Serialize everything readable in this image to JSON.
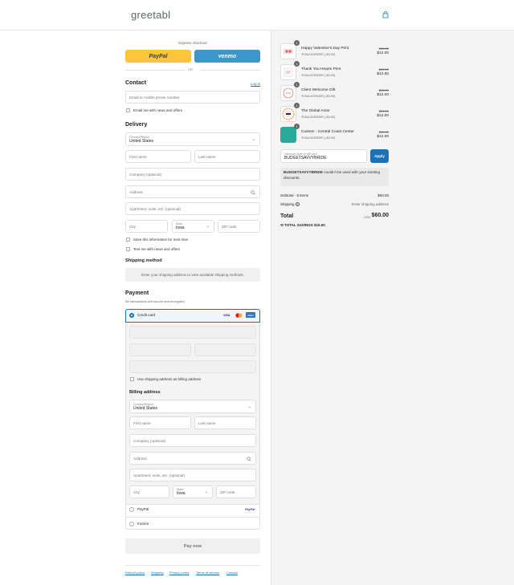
{
  "header": {
    "logo": "greetabl"
  },
  "express": {
    "title": "Express checkout",
    "paypal": "PayPal",
    "venmo": "venmo",
    "or": "OR"
  },
  "contact": {
    "title": "Contact",
    "login": "Log in",
    "email_placeholder": "Email or mobile phone number",
    "email_news": "Email me with news and offers"
  },
  "delivery": {
    "title": "Delivery",
    "country_label": "Country/Region",
    "country_value": "United States",
    "first_name": "First name",
    "last_name": "Last name",
    "company": "Company (optional)",
    "address": "Address",
    "apartment": "Apartment, suite, etc. (optional)",
    "city": "City",
    "state_label": "State",
    "state_value": "Iowa",
    "zip": "ZIP code",
    "save_info": "Save this information for next time",
    "text_news": "Text me with news and offers"
  },
  "shipping": {
    "title": "Shipping method",
    "placeholder": "Enter your shipping address to view available shipping methods."
  },
  "payment": {
    "title": "Payment",
    "subtitle": "All transactions are secure and encrypted.",
    "credit_card": "Credit card",
    "visa": "VISA",
    "amex": "AMEX",
    "use_shipping": "Use shipping address as billing address",
    "paypal": "PayPal",
    "paypal_logo": "PayPal",
    "invoice": "Invoice"
  },
  "billing": {
    "title": "Billing address",
    "country_label": "Country/Region",
    "country_value": "United States",
    "first_name": "First name",
    "last_name": "Last name",
    "company": "Company (optional)",
    "address": "Address",
    "apartment": "Apartment, suite, etc. (optional)",
    "city": "City",
    "state_label": "State",
    "state_value": "Iowa",
    "zip": "ZIP code"
  },
  "pay_now": "Pay now",
  "footer": {
    "refund": "Refund policy",
    "shipping": "Shipping",
    "privacy": "Privacy policy",
    "terms": "Terms of service",
    "contact": "Contact"
  },
  "items": [
    {
      "name": "Happy Valentine's Day Print",
      "code": "BULKORDER (-$3.00)",
      "old": "$15.00",
      "price": "$12.00",
      "qty": "1"
    },
    {
      "name": "Thank You Hearts Print",
      "code": "BULKORDER (-$3.00)",
      "old": "$15.00",
      "price": "$12.00",
      "qty": "1"
    },
    {
      "name": "Client Welcome Gift",
      "code": "BULKORDER (-$3.00)",
      "old": "$15.00",
      "price": "$12.00",
      "qty": "1"
    },
    {
      "name": "The Global Actor",
      "code": "BULKORDER (-$3.00)",
      "old": "$15.00",
      "price": "$12.00",
      "qty": "1"
    },
    {
      "name": "Custom - Central Coast Center",
      "code": "BULKORDER (-$3.00)",
      "old": "$15.00",
      "price": "$12.00",
      "qty": "1"
    }
  ],
  "discount": {
    "label": "Discount code or gift card",
    "value": "BUDGETSAVVYBRIDE",
    "apply": "Apply",
    "error_code": "BUDGETSAVVYBRIDE",
    "error_text": " couldn't be used with your existing discounts."
  },
  "summary": {
    "subtotal_label": "Subtotal · 5 items",
    "subtotal": "$60.00",
    "shipping_label": "Shipping",
    "shipping_value": "Enter shipping address",
    "total_label": "Total",
    "currency": "USD",
    "total": "$60.00",
    "savings_label": "TOTAL SAVINGS",
    "savings": "$15.00"
  },
  "colors": {
    "accent": "#1a73b9",
    "paypal": "#ffc439",
    "venmo": "#3d95ce",
    "teal": "#2aaa9a"
  }
}
